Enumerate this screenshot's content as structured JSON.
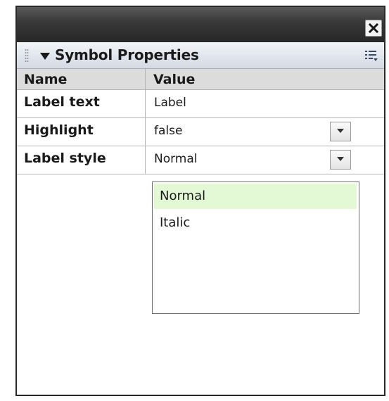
{
  "panel": {
    "title": "Symbol Properties"
  },
  "table": {
    "headers": {
      "name": "Name",
      "value": "Value"
    },
    "rows": [
      {
        "name": "Label text",
        "value": "Label"
      },
      {
        "name": "Highlight",
        "value": "false"
      },
      {
        "name": "Label style",
        "value": "Normal"
      }
    ]
  },
  "dropdown": {
    "options": [
      "Normal",
      "Italic"
    ],
    "selected": "Normal"
  },
  "colors": {
    "titlebar": "#2b2b2b",
    "panel_header": "#dfe4ec",
    "column_header": "#dcdcdc",
    "selected_option": "#e3f9d6"
  },
  "icons": {
    "close": "close-icon",
    "grip": "grip-icon",
    "collapse": "collapse-arrow-icon",
    "options": "panel-options-icon",
    "dropdown": "dropdown-arrow-icon"
  }
}
